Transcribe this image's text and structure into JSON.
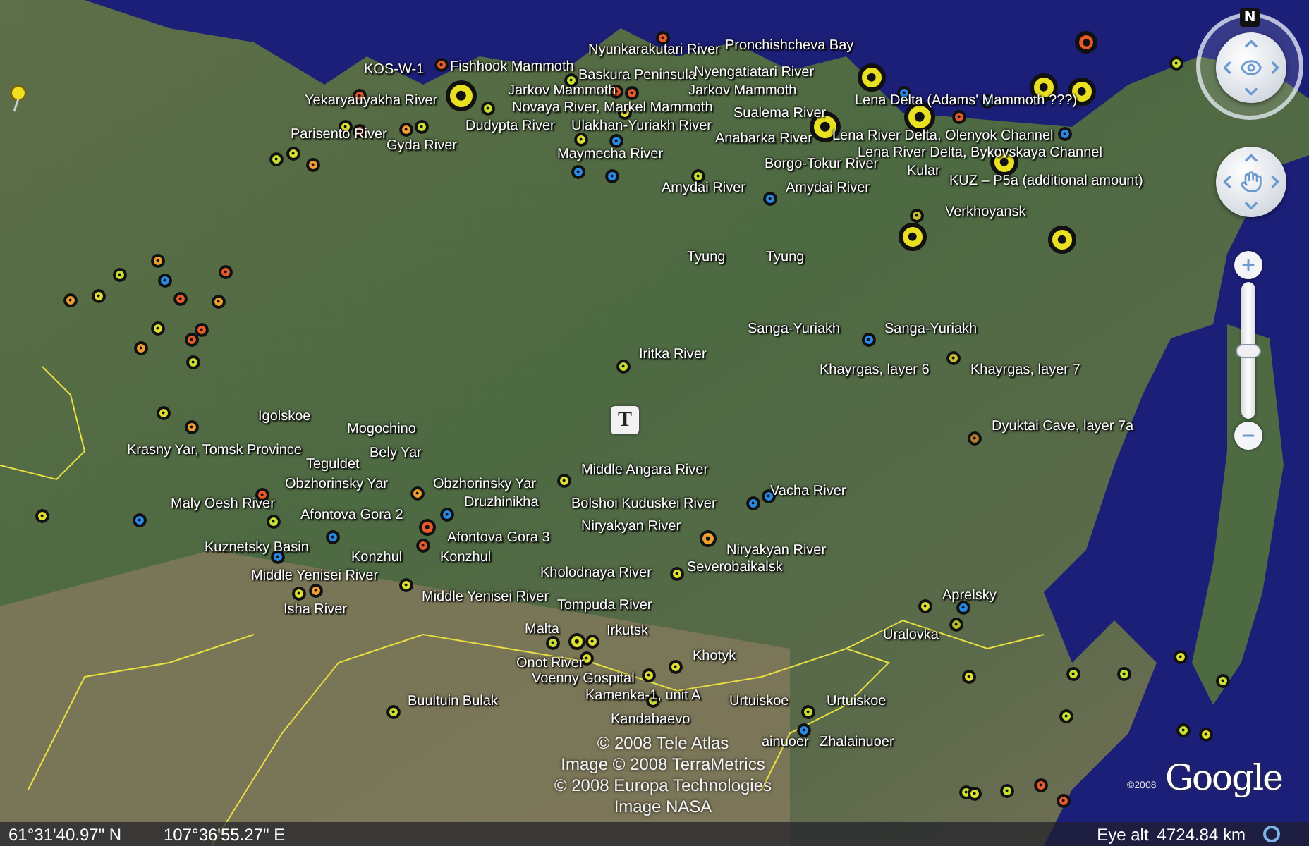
{
  "place_labels": [
    "KOS-W-1",
    "Fishhook Mammoth",
    "Nyunkarakutari River",
    "Pronchishcheva Bay",
    "Baskura Peninsula",
    "Nyengatiatari River",
    "Jarkov Mammoth",
    "Jarkov Mammoth",
    "Yekaryauyakha River",
    "Novaya River, Markel Mammoth",
    "Sualema River",
    "Lena Delta (Adams' Mammoth ???)",
    "Dudypta River",
    "Ulakhan-Yuriakh River",
    "Parisento River",
    "Gyda River",
    "Anabarka River",
    "Lena River Delta, Olenyok Channel",
    "Maymecha River",
    "Lena River Delta, Bykovskaya Channel",
    "Borgo-Tokur River",
    "Kular",
    "KUZ – P5a (additional amount)",
    "Amydai River",
    "Amydai River",
    "Verkhoyansk",
    "Tyung",
    "Tyung",
    "Sanga-Yuriakh",
    "Sanga-Yuriakh",
    "Iritka River",
    "Khayrgas, layer 6",
    "Khayrgas, layer 7",
    "Dyuktai Cave, layer 7a",
    "Middle Angara River",
    "Vacha River",
    "Bolshoi Kuduskei River",
    "Niryakyan River",
    "Niryakyan River",
    "Kholodnaya River",
    "Severobaikalsk",
    "Igolskoe",
    "Mogochino",
    "Krasny Yar, Tomsk Province",
    "Teguldet",
    "Bely Yar",
    "Obzhorinsky Yar",
    "Obzhorinsky Yar",
    "Maly Oesh River",
    "Druzhinikha",
    "Afontova Gora 2",
    "Afontova Gora 3",
    "Kuznetsky Basin",
    "Konzhul",
    "Konzhul",
    "Middle Yenisei River",
    "Isha River",
    "Middle Yenisei River",
    "Tompuda River",
    "Malta",
    "Irkutsk",
    "Khotyk",
    "Onot River",
    "Voenny Gospital",
    "Buultuin Bulak",
    "Kamenka-1, unit A",
    "Urtuiskoe",
    "Urtuiskoe",
    "Kandabaevo",
    "ainuoer",
    "Zhalainuoer",
    "Aprelsky",
    "Uralovka"
  ],
  "markers": [
    {
      "color": "#e85a2a"
    },
    {
      "color": "#e8e020"
    },
    {
      "color": "#c8e030"
    },
    {
      "color": "#e85a2a"
    },
    {
      "color": "#e0e030"
    },
    {
      "color": "#e85a2a"
    },
    {
      "color": "#f0a030"
    },
    {
      "color": "#c8e030"
    },
    {
      "color": "#d8e030"
    },
    {
      "color": "#f0a030"
    },
    {
      "color": "#c8e030"
    },
    {
      "color": "#e85a2a"
    },
    {
      "color": "#c8e030"
    },
    {
      "color": "#e85a2a"
    },
    {
      "color": "#e85a2a"
    },
    {
      "color": "#e0e030"
    },
    {
      "color": "#e0e030"
    },
    {
      "color": "#2a8ae8"
    },
    {
      "color": "#2a8ae8"
    },
    {
      "color": "#2a8ae8"
    },
    {
      "color": "#2a8ae8"
    },
    {
      "color": "#c8e030"
    },
    {
      "color": "#e8e020"
    },
    {
      "color": "#e8e020"
    },
    {
      "color": "#2a8ae8"
    },
    {
      "color": "#e8e020"
    },
    {
      "color": "#e85a2a"
    },
    {
      "color": "#2a8ae8"
    },
    {
      "color": "#e8e020"
    },
    {
      "color": "#e8e020"
    },
    {
      "color": "#e85a2a"
    },
    {
      "color": "#2a8ae8"
    },
    {
      "color": "#e8e020"
    },
    {
      "color": "#e8e020"
    },
    {
      "color": "#e8e020"
    },
    {
      "color": "#c8c030"
    },
    {
      "color": "#c8e030"
    },
    {
      "color": "#f0a030"
    },
    {
      "color": "#2a8ae8"
    },
    {
      "color": "#e85a2a"
    },
    {
      "color": "#f0a030"
    },
    {
      "color": "#e85a2a"
    },
    {
      "color": "#e0e030"
    },
    {
      "color": "#e85a2a"
    },
    {
      "color": "#c8e030"
    },
    {
      "color": "#e0e030"
    },
    {
      "color": "#f0a030"
    },
    {
      "color": "#f0a030"
    },
    {
      "color": "#c8e030"
    },
    {
      "color": "#f0a030"
    },
    {
      "color": "#e0e030"
    },
    {
      "color": "#c8e030"
    },
    {
      "color": "#e0e030"
    },
    {
      "color": "#2a8ae8"
    },
    {
      "color": "#c8c030"
    },
    {
      "color": "#b88030"
    },
    {
      "color": "#2a8ae8"
    },
    {
      "color": "#2a8ae8"
    },
    {
      "color": "#f0a030"
    },
    {
      "color": "#e85a2a"
    },
    {
      "color": "#c8e030"
    },
    {
      "color": "#2a8ae8"
    },
    {
      "color": "#e85a2a"
    },
    {
      "color": "#e85a2a"
    },
    {
      "color": "#2a8ae8"
    },
    {
      "color": "#f0a030"
    },
    {
      "color": "#2a8ae8"
    },
    {
      "color": "#f0a030"
    },
    {
      "color": "#e0e030"
    },
    {
      "color": "#e0e030"
    },
    {
      "color": "#e0e030"
    },
    {
      "color": "#c8e030"
    },
    {
      "color": "#e0e030"
    },
    {
      "color": "#e0e030"
    },
    {
      "color": "#e0e030"
    },
    {
      "color": "#e0e030"
    },
    {
      "color": "#e0e030"
    },
    {
      "color": "#c8e030"
    },
    {
      "color": "#c8e030"
    },
    {
      "color": "#c8e030"
    },
    {
      "color": "#2a8ae8"
    },
    {
      "color": "#e0e030"
    },
    {
      "color": "#2a8ae8"
    },
    {
      "color": "#b8c030"
    },
    {
      "color": "#e0e030"
    },
    {
      "color": "#c8e030"
    },
    {
      "color": "#c8e030"
    },
    {
      "color": "#c8e030"
    },
    {
      "color": "#e85a2a"
    },
    {
      "color": "#e85a2a"
    },
    {
      "color": "#c8e030"
    },
    {
      "color": "#e0e030"
    },
    {
      "color": "#c8e030"
    },
    {
      "color": "#e0e030"
    },
    {
      "color": "#c8e030"
    },
    {
      "color": "#c8e030"
    },
    {
      "color": "#e0e030"
    },
    {
      "color": "#2a8ae8"
    },
    {
      "color": "#e0e030"
    },
    {
      "color": "#e85a2a"
    }
  ],
  "news_badge": "T",
  "compass": {
    "north": "N"
  },
  "zoom_slider": {
    "level": 0.5
  },
  "attribution": [
    "© 2008 Tele Atlas",
    "Image © 2008 TerraMetrics",
    "© 2008 Europa Technologies",
    "Image NASA"
  ],
  "logo": {
    "copyright": "©2008",
    "name": "Google"
  },
  "status_bar": {
    "latitude": "61°31'40.97\" N",
    "longitude": "107°36'55.27\" E",
    "eye_alt_label": "Eye alt",
    "eye_alt_value": "4724.84 km"
  }
}
